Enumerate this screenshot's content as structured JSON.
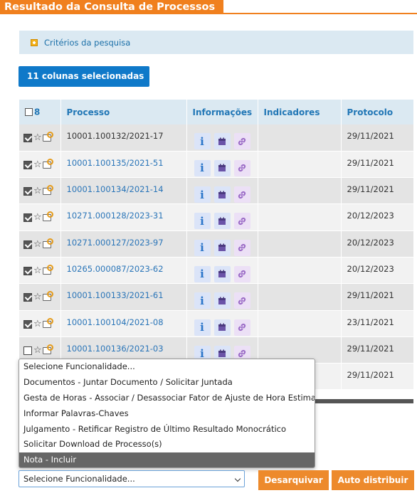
{
  "header": {
    "title": "Resultado da Consulta de Processos"
  },
  "criteria": {
    "label": "Critérios da pesquisa"
  },
  "columns_button": {
    "label": "11 colunas selecionadas"
  },
  "table": {
    "headers": {
      "count": "8",
      "processo": "Processo",
      "informacoes": "Informações",
      "indicadores": "Indicadores",
      "protocolo": "Protocolo"
    },
    "rows": [
      {
        "processo": "10001.100132/2021-17",
        "protocolo": "29/11/2021",
        "checked": true,
        "link": false
      },
      {
        "processo": "10001.100135/2021-51",
        "protocolo": "29/11/2021",
        "checked": true,
        "link": true
      },
      {
        "processo": "10001.100134/2021-14",
        "protocolo": "29/11/2021",
        "checked": true,
        "link": true
      },
      {
        "processo": "10271.000128/2023-31",
        "protocolo": "20/12/2023",
        "checked": true,
        "link": true
      },
      {
        "processo": "10271.000127/2023-97",
        "protocolo": "20/12/2023",
        "checked": true,
        "link": true
      },
      {
        "processo": "10265.000087/2023-62",
        "protocolo": "20/12/2023",
        "checked": true,
        "link": true
      },
      {
        "processo": "10001.100133/2021-61",
        "protocolo": "29/11/2021",
        "checked": true,
        "link": true
      },
      {
        "processo": "10001.100104/2021-08",
        "protocolo": "23/11/2021",
        "checked": true,
        "link": true
      },
      {
        "processo": "10001.100136/2021-03",
        "protocolo": "29/11/2021",
        "checked": false,
        "link": true
      },
      {
        "processo": "",
        "protocolo": "29/11/2021",
        "checked": false,
        "link": true
      }
    ]
  },
  "dropdown": {
    "options": [
      "Selecione Funcionalidade...",
      "Documentos - Juntar Documento / Solicitar Juntada",
      "Gesta de Horas - Associar / Desassociar Fator de Ajuste de Hora Estimada",
      "Informar Palavras-Chaves",
      "Julgamento - Retificar Registro de Último Resultado Monocrático",
      "Solicitar Download de Processo(s)",
      "Nota - Incluir"
    ],
    "highlighted_index": 6,
    "selected": "Selecione Funcionalidade..."
  },
  "buttons": {
    "desarquivar": "Desarquivar",
    "auto_distribuir": "Auto distribuir"
  },
  "colors": {
    "accent_orange": "#f0801e",
    "primary_blue": "#0f79c9",
    "link_blue": "#2a75b8"
  },
  "icons": {
    "info": "info-icon",
    "calendar": "calendar-icon",
    "link": "link-icon",
    "star": "star-icon",
    "tag": "tag-icon"
  }
}
